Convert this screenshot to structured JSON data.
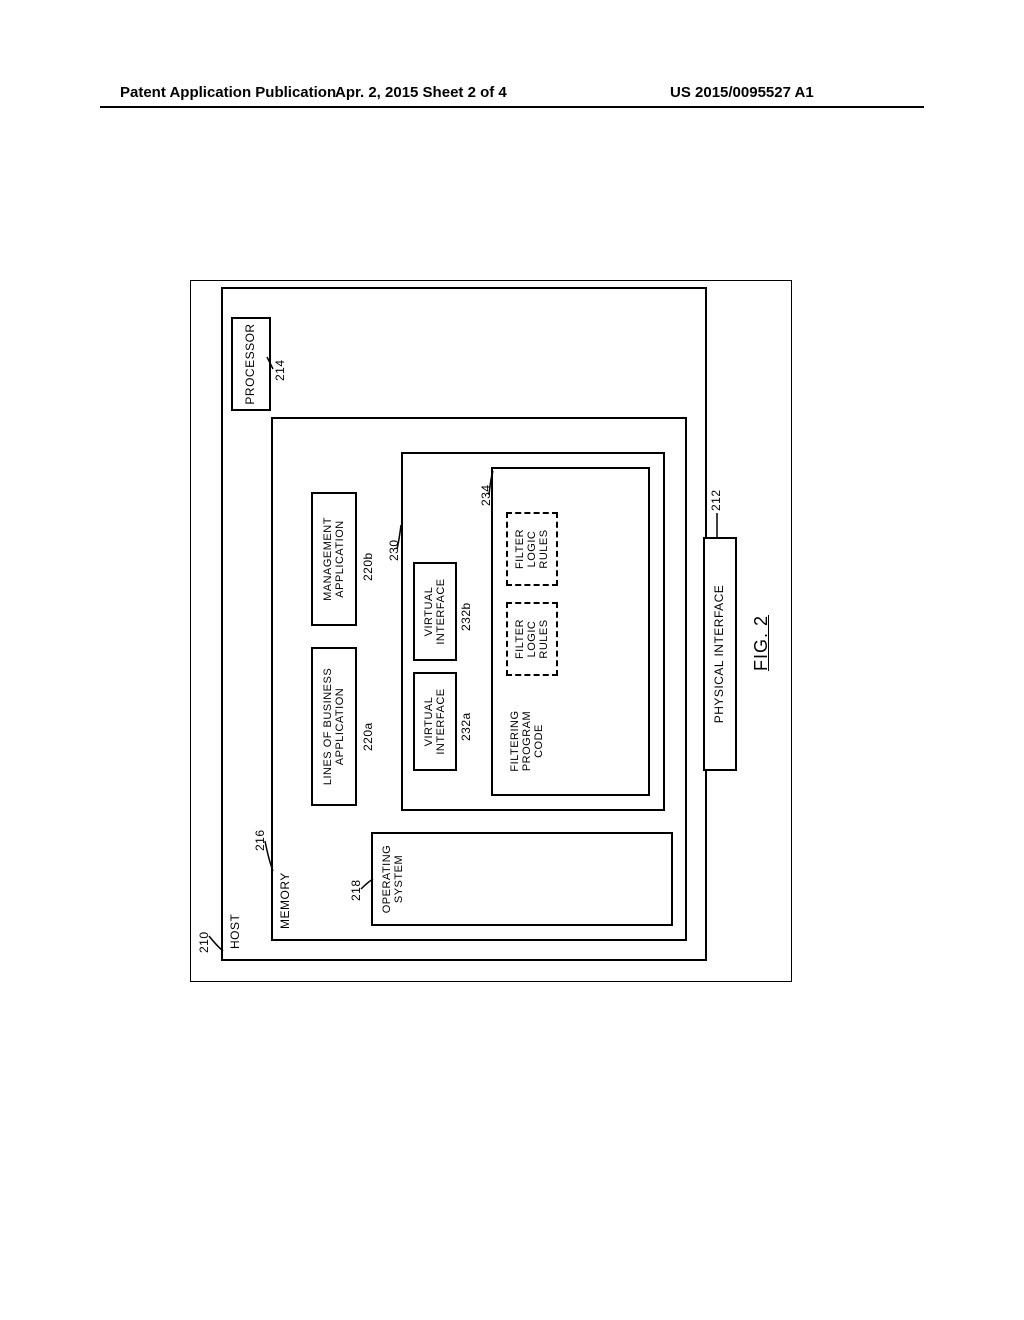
{
  "header": {
    "left": "Patent Application Publication",
    "center": "Apr. 2, 2015  Sheet 2 of 4",
    "right": "US 2015/0095527 A1"
  },
  "fig": {
    "caption": "FIG. 2",
    "host_label": "HOST",
    "memory_label": "MEMORY",
    "processor_label": "PROCESSOR",
    "os_label": "OPERATING\nSYSTEM",
    "lob_label": "LINES OF BUSINESS\nAPPLICATION",
    "mgmt_label": "MANAGEMENT\nAPPLICATION",
    "virt_iface_label": "VIRTUAL\nINTERFACE",
    "filter_code_label": "FILTERING\nPROGRAM\nCODE",
    "filter_rules_label": "FILTER\nLOGIC\nRULES",
    "phys_iface_label": "PHYSICAL INTERFACE",
    "refs": {
      "r210": "210",
      "r212": "212",
      "r214": "214",
      "r216": "216",
      "r218": "218",
      "r220a": "220a",
      "r220b": "220b",
      "r230": "230",
      "r232a": "232a",
      "r232b": "232b",
      "r234": "234"
    }
  }
}
